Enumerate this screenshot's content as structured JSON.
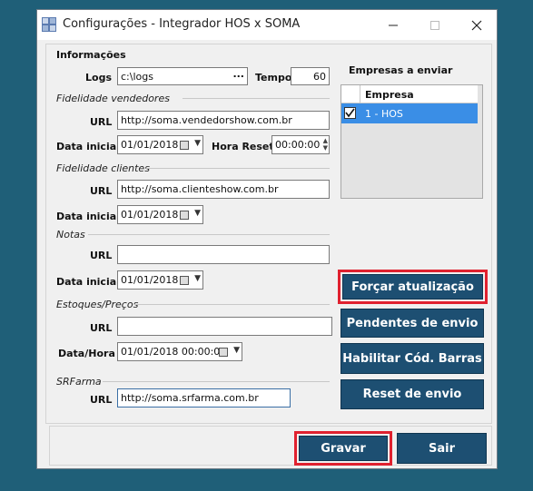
{
  "window": {
    "title": "Configurações - Integrador HOS x SOMA"
  },
  "info": {
    "group_label": "Informações",
    "logs_label": "Logs",
    "logs_value": "c:\\logs",
    "logs_browse": "...",
    "tempo_label": "Tempo",
    "tempo_value": "60"
  },
  "vendedores": {
    "section": "Fidelidade vendedores",
    "url_label": "URL",
    "url_value": "http://soma.vendedorshow.com.br",
    "date_label": "Data inicial",
    "date_value": "01/01/2018",
    "reset_label": "Hora Reset",
    "reset_value": "00:00:00"
  },
  "clientes": {
    "section": "Fidelidade clientes",
    "url_label": "URL",
    "url_value": "http://soma.clienteshow.com.br",
    "date_label": "Data inicial",
    "date_value": "01/01/2018"
  },
  "notas": {
    "section": "Notas",
    "url_label": "URL",
    "url_value": "",
    "date_label": "Data inicial",
    "date_value": "01/01/2018"
  },
  "estoques": {
    "section": "Estoques/Preços",
    "url_label": "URL",
    "url_value": "",
    "datetime_label": "Data/Hora",
    "datetime_value": "01/01/2018 00:00:00"
  },
  "srfarma": {
    "section": "SRFarma",
    "url_label": "URL",
    "url_value": "http://soma.srfarma.com.br"
  },
  "empresas": {
    "label": "Empresas a enviar",
    "column": "Empresa",
    "rows": [
      {
        "name": "1 - HOS",
        "checked": true
      }
    ]
  },
  "buttons": {
    "forcar": "Forçar atualização",
    "pendentes": "Pendentes de envio",
    "habilitar": "Habilitar Cód. Barras",
    "reset": "Reset de envio",
    "gravar": "Gravar",
    "sair": "Sair"
  },
  "colors": {
    "accent": "#1d4f72",
    "highlight": "#e0212f",
    "background": "#1f5f78"
  }
}
